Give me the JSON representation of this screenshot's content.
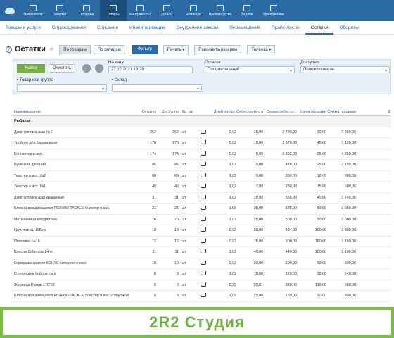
{
  "topnav": [
    {
      "label": "Показатели"
    },
    {
      "label": "Закупки"
    },
    {
      "label": "Продажи"
    },
    {
      "label": "Товары",
      "active": true
    },
    {
      "label": "Контрагенты"
    },
    {
      "label": "Деньги"
    },
    {
      "label": "Розница"
    },
    {
      "label": "Производство"
    },
    {
      "label": "Задачи"
    },
    {
      "label": "Приложения"
    }
  ],
  "subtabs": [
    {
      "label": "Товары и услуги"
    },
    {
      "label": "Оприходования"
    },
    {
      "label": "Списания"
    },
    {
      "label": "Инвентаризации"
    },
    {
      "label": "Внутренние заказы"
    },
    {
      "label": "Перемещения"
    },
    {
      "label": "Прайс-листы"
    },
    {
      "label": "Остатки",
      "active": true
    },
    {
      "label": "Обороты"
    }
  ],
  "header": {
    "title": "Остатки",
    "seg_goods": "По товарам",
    "seg_warehouses": "По складам",
    "filter": "Фильтр",
    "print": "Печать",
    "refill": "Пополнить резервы",
    "cart": "Тележка"
  },
  "filters": {
    "find": "Найти",
    "clear": "Очистить",
    "date_label": "На дату",
    "date_value": "27.12.2021 13:28",
    "stock_label": "Остаток",
    "stock_value": "Положительный",
    "available_label": "Доступно",
    "available_value": "Положительное",
    "product_label": "Товар или группа",
    "warehouse_label": "Склад"
  },
  "columns": [
    "Наименование",
    "Остаток",
    "Доступно",
    "Ед. изм.",
    "",
    "Дней на скл.",
    "Себестоимость",
    "Сумма себесто...",
    "Цена продажи",
    "Сумма продажи"
  ],
  "group_name": "Рыбалка",
  "rows": [
    {
      "name": "Джиг-головка шар №1",
      "stock": "252",
      "avail": "252",
      "unit": "шт",
      "days": "0,92",
      "cost": "15,00",
      "cost_sum": "3 780,00",
      "price": "30,00",
      "price_sum": "7 560,00"
    },
    {
      "name": "Тройник для балансиров",
      "stock": "178",
      "avail": "178",
      "unit": "шт",
      "days": "0,92",
      "cost": "15,00",
      "cost_sum": "2 670,00",
      "price": "40,00",
      "price_sum": "7 120,00"
    },
    {
      "name": "Коннектор в асс.",
      "stock": "174",
      "avail": "174",
      "unit": "шт",
      "days": "0,92",
      "cost": "8,00",
      "cost_sum": "1 392,00",
      "price": "25,00",
      "price_sum": "4 350,00"
    },
    {
      "name": "Бубенчик двойной",
      "stock": "86",
      "avail": "86",
      "unit": "шт",
      "days": "1,02",
      "cost": "5,00",
      "cost_sum": "430,00",
      "price": "25,00",
      "price_sum": "2 150,00"
    },
    {
      "name": "Твистер в асс. №2",
      "stock": "60",
      "avail": "60",
      "unit": "шт",
      "days": "1,02",
      "cost": "5,00",
      "cost_sum": "300,00",
      "price": "10,00",
      "price_sum": "600,00"
    },
    {
      "name": "Твистер в асс. №1",
      "stock": "40",
      "avail": "40",
      "unit": "шт",
      "days": "1,02",
      "cost": "7,00",
      "cost_sum": "280,00",
      "price": "15,00",
      "price_sum": "600,00"
    },
    {
      "name": "Джиг-головка шар крашеный",
      "stock": "31",
      "avail": "31",
      "unit": "шт",
      "days": "1,02",
      "cost": "18,00",
      "cost_sum": "558,00",
      "price": "40,00",
      "price_sum": "1 240,00"
    },
    {
      "name": "Блесна вращающаяся FISHING TACKLE блистер в асс.",
      "stock": "21",
      "avail": "21",
      "unit": "шт",
      "days": "1,09",
      "cost": "25,00",
      "cost_sum": "525,00",
      "price": "50,00",
      "price_sum": "1 050,00"
    },
    {
      "name": "Мотыльница квадратная",
      "stock": "20",
      "avail": "20",
      "unit": "шт",
      "days": "1,02",
      "cost": "25,00",
      "cost_sum": "500,00",
      "price": "50,00",
      "price_sum": "1 000,00"
    },
    {
      "name": "Груз ложка, 168 гр.",
      "stock": "18",
      "avail": "18",
      "unit": "шт",
      "days": "0,92",
      "cost": "33,00",
      "cost_sum": "594,00",
      "price": "100,00",
      "price_sum": "1 800,00"
    },
    {
      "name": "Поплавок №16",
      "stock": "12",
      "avail": "12",
      "unit": "шт",
      "days": "0,92",
      "cost": "75,00",
      "cost_sum": "900,00",
      "price": "180,00",
      "price_sum": "2 160,00"
    },
    {
      "name": "Блесна Columbia 14гр.",
      "stock": "11",
      "avail": "11",
      "unit": "шт",
      "days": "1,02",
      "cost": "40,00",
      "cost_sum": "440,00",
      "price": "100,00",
      "price_sum": "1 100,00"
    },
    {
      "name": "Кормушка зимняя КОНУС металлическая",
      "stock": "10",
      "avail": "10",
      "unit": "шт",
      "days": "0,92",
      "cost": "20,00",
      "cost_sum": "200,00",
      "price": "50,00",
      "price_sum": "500,00"
    },
    {
      "name": "Стопор для бойлов carp",
      "stock": "8",
      "avail": "8",
      "unit": "шт",
      "days": "1,02",
      "cost": "15,00",
      "cost_sum": "120,00",
      "price": "30,00",
      "price_sum": "240,00"
    },
    {
      "name": "Жерлица Ермак 170*63",
      "stock": "6",
      "avail": "6",
      "unit": "шт",
      "days": "0,95",
      "cost": "55,01",
      "cost_sum": "330,06",
      "price": "110,00",
      "price_sum": "660,00"
    },
    {
      "name": "Блесна вращающаяся FISHING TACKLE блистер в асс. с опушкой",
      "stock": "6",
      "avail": "6",
      "unit": "шт",
      "days": "1,09",
      "cost": "25,00",
      "cost_sum": "150,00",
      "price": "50,00",
      "price_sum": "300,00"
    }
  ],
  "banner": "2R2 Студия"
}
